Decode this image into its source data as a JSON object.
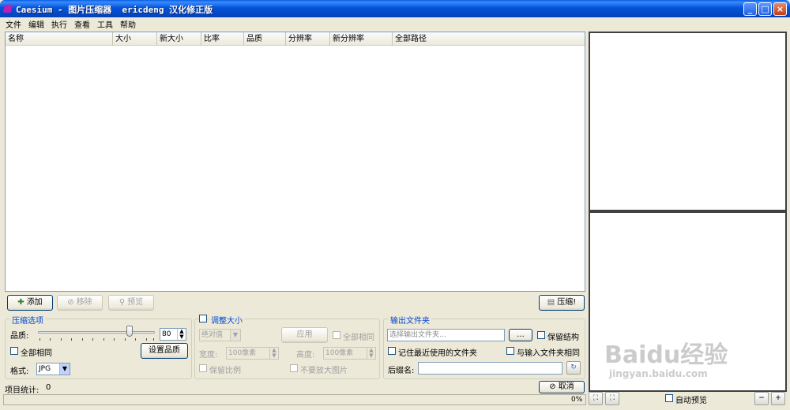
{
  "window": {
    "title": "Caesium - 图片压缩器  ericdeng 汉化修正版"
  },
  "menu": {
    "items": [
      "文件",
      "编辑",
      "执行",
      "查看",
      "工具",
      "帮助"
    ]
  },
  "list": {
    "columns": [
      "名称",
      "大小",
      "新大小",
      "比率",
      "品质",
      "分辨率",
      "新分辨率",
      "全部路径"
    ]
  },
  "actions": {
    "add": "添加",
    "remove": "移除",
    "preview": "预览",
    "compress": "压缩!"
  },
  "compression": {
    "legend": "压缩选项",
    "quality_label": "品质:",
    "quality_value": "80",
    "quality_level_percent": 80,
    "same_for_all": "全部相同",
    "set_quality": "设置品质",
    "format_label": "格式:",
    "format_value": "JPG"
  },
  "resize": {
    "legend": "调整大小",
    "mode": "绝对值",
    "apply": "应用",
    "same_for_all": "全部相同",
    "width_label": "宽度:",
    "width_value": "100像素",
    "height_label": "高度:",
    "height_value": "100像素",
    "keep_ratio": "保留比例",
    "no_enlarge": "不要放大图片"
  },
  "output": {
    "legend": "输出文件夹",
    "placeholder": "选择输出文件夹...",
    "browse": "...",
    "keep_structure": "保留结构",
    "remember_folder": "记住最近使用的文件夹",
    "same_as_input": "与输入文件夹相同",
    "suffix_label": "后缀名:"
  },
  "status": {
    "items_label": "项目统计:",
    "items_count": "0",
    "cancel": "取消",
    "progress": "0%",
    "auto_preview": "自动预览"
  },
  "watermark": {
    "brand": "Baidu经验",
    "url": "jingyan.baidu.com"
  }
}
